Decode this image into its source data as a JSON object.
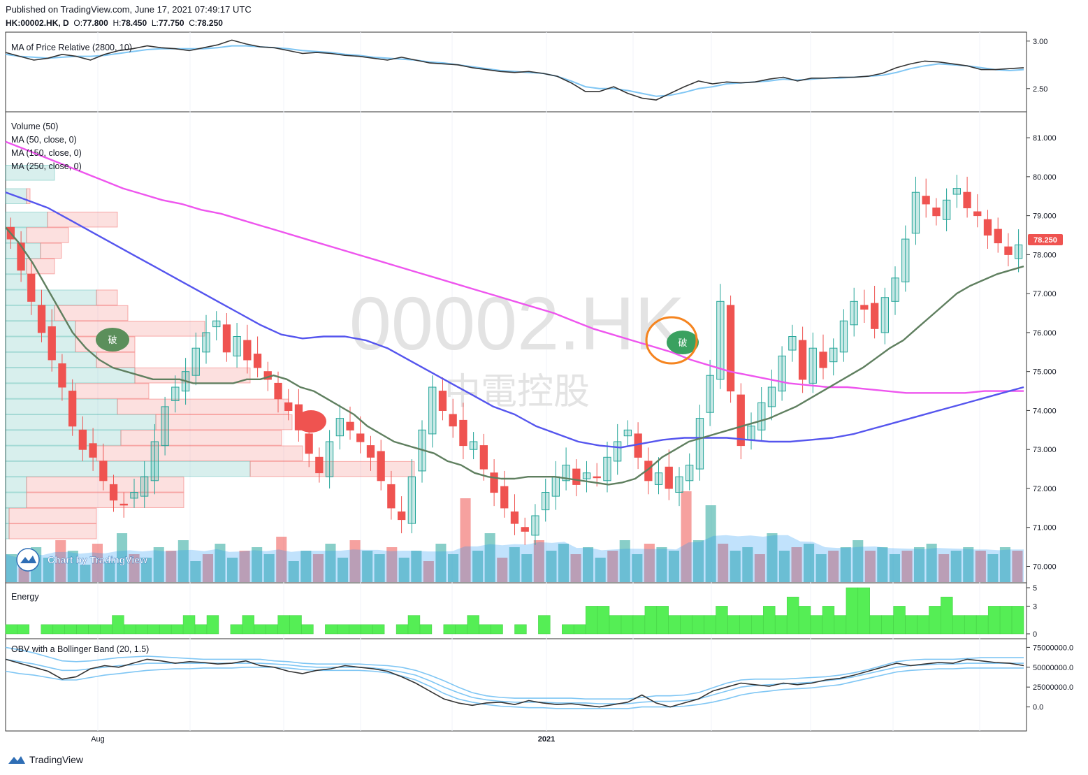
{
  "header": {
    "published": "Published on TradingView.com, June 17, 2021 07:49:17 UTC",
    "symbol_line": "HK:00002.HK, D",
    "ohlc": {
      "o": "77.800",
      "h": "78.450",
      "l": "77.750",
      "c": "78.250"
    }
  },
  "watermark": {
    "symbol": "00002.HK",
    "name": "中電控股"
  },
  "badge_text": "破",
  "brand": {
    "chart_by": "Chart by TradingView",
    "footer": "TradingView"
  },
  "colors": {
    "up": "#26a69a",
    "down": "#ef5350",
    "ma50": "#5f7f5f",
    "ma150": "#5555ee",
    "ma250": "#ee55ee",
    "energy": "#55ee55",
    "obv": "#333333",
    "band": "#7fc6f4",
    "annotation": "#f5841f"
  },
  "chart_data": [
    {
      "type": "line",
      "title": "MA of Price Relative (2800, 10)",
      "y_ticks": [
        "3.00",
        "2.50"
      ],
      "ylim": [
        2.3,
        3.05
      ],
      "series": [
        {
          "values": [
            2.88,
            2.84,
            2.8,
            2.82,
            2.86,
            2.84,
            2.8,
            2.86,
            2.9,
            2.92,
            2.95,
            2.93,
            2.92,
            2.9,
            2.93,
            2.96,
            3.01,
            2.97,
            2.94,
            2.93,
            2.9,
            2.87,
            2.88,
            2.87,
            2.85,
            2.84,
            2.82,
            2.8,
            2.83,
            2.8,
            2.77,
            2.76,
            2.75,
            2.72,
            2.7,
            2.68,
            2.67,
            2.68,
            2.66,
            2.63,
            2.56,
            2.47,
            2.47,
            2.52,
            2.45,
            2.4,
            2.38,
            2.45,
            2.52,
            2.58,
            2.55,
            2.57,
            2.56,
            2.57,
            2.6,
            2.62,
            2.58,
            2.61,
            2.61,
            2.62,
            2.62,
            2.63,
            2.66,
            2.72,
            2.76,
            2.79,
            2.78,
            2.76,
            2.74,
            2.7,
            2.7,
            2.71,
            2.72
          ]
        },
        {
          "values": [
            2.86,
            2.84,
            2.83,
            2.82,
            2.83,
            2.84,
            2.84,
            2.85,
            2.87,
            2.89,
            2.91,
            2.92,
            2.92,
            2.92,
            2.92,
            2.93,
            2.95,
            2.95,
            2.94,
            2.93,
            2.92,
            2.9,
            2.89,
            2.88,
            2.86,
            2.85,
            2.83,
            2.82,
            2.81,
            2.8,
            2.78,
            2.77,
            2.75,
            2.73,
            2.71,
            2.69,
            2.68,
            2.67,
            2.66,
            2.63,
            2.58,
            2.52,
            2.5,
            2.5,
            2.48,
            2.45,
            2.42,
            2.43,
            2.46,
            2.5,
            2.52,
            2.55,
            2.56,
            2.57,
            2.58,
            2.6,
            2.59,
            2.6,
            2.61,
            2.61,
            2.62,
            2.63,
            2.64,
            2.67,
            2.71,
            2.74,
            2.76,
            2.75,
            2.74,
            2.72,
            2.7,
            2.69,
            2.7
          ]
        }
      ]
    },
    {
      "type": "candlestick",
      "legend": [
        "Volume (50)",
        "MA (50, close, 0)",
        "MA (150, close, 0)",
        "MA (250, close, 0)"
      ],
      "y_ticks": [
        "81.000",
        "80.000",
        "79.000",
        "78.000",
        "77.000",
        "76.000",
        "75.000",
        "74.000",
        "73.000",
        "72.000",
        "71.000",
        "70.000"
      ],
      "ylim": [
        69.65,
        81.45
      ],
      "x_labels": [
        "Aug",
        "2021"
      ],
      "last_price": "78.250",
      "close": [
        78.4,
        77.6,
        76.8,
        76.0,
        75.3,
        74.6,
        73.6,
        73.0,
        72.8,
        72.2,
        71.7,
        71.6,
        71.9,
        72.3,
        73.2,
        74.1,
        74.6,
        75.0,
        75.6,
        76.0,
        76.3,
        75.5,
        75.9,
        75.3,
        75.1,
        74.8,
        74.3,
        74.0,
        73.5,
        72.9,
        72.4,
        73.2,
        73.8,
        73.5,
        73.2,
        72.8,
        72.2,
        71.5,
        71.2,
        72.3,
        73.5,
        74.6,
        74.0,
        73.6,
        73.1,
        73.2,
        72.5,
        71.9,
        71.5,
        71.1,
        70.9,
        71.3,
        71.9,
        72.3,
        72.6,
        72.1,
        72.4,
        72.3,
        72.8,
        73.2,
        73.5,
        72.8,
        72.2,
        72.4,
        72.0,
        72.3,
        72.6,
        73.8,
        74.9,
        76.8,
        74.5,
        73.1,
        73.6,
        74.2,
        74.6,
        75.4,
        75.9,
        74.8,
        75.6,
        75.1,
        75.6,
        76.3,
        76.8,
        76.6,
        76.1,
        76.9,
        77.4,
        78.4,
        79.6,
        79.3,
        79.0,
        79.4,
        79.7,
        79.2,
        79.0,
        78.5,
        78.3,
        78.0,
        78.25
      ],
      "ma50": [
        78.7,
        78.3,
        77.8,
        77.2,
        76.6,
        76.0,
        75.6,
        75.3,
        75.1,
        75.0,
        74.9,
        74.8,
        74.8,
        74.8,
        74.7,
        74.7,
        74.7,
        74.7,
        74.8,
        74.8,
        74.9,
        74.8,
        74.6,
        74.5,
        74.3,
        74.1,
        73.9,
        73.6,
        73.4,
        73.2,
        73.1,
        73.0,
        72.9,
        72.7,
        72.6,
        72.4,
        72.3,
        72.25,
        72.25,
        72.3,
        72.3,
        72.3,
        72.25,
        72.2,
        72.15,
        72.1,
        72.15,
        72.25,
        72.5,
        72.8,
        73.0,
        73.2,
        73.3,
        73.4,
        73.5,
        73.6,
        73.7,
        73.8,
        73.95,
        74.1,
        74.3,
        74.5,
        74.7,
        74.9,
        75.1,
        75.35,
        75.6,
        75.8,
        76.1,
        76.4,
        76.7,
        77.0,
        77.2,
        77.35,
        77.5,
        77.6,
        77.7
      ],
      "ma150": [
        79.6,
        79.4,
        79.2,
        78.9,
        78.6,
        78.3,
        78.0,
        77.7,
        77.4,
        77.1,
        76.8,
        76.5,
        76.2,
        75.95,
        75.85,
        75.9,
        75.9,
        75.8,
        75.6,
        75.3,
        75.0,
        74.7,
        74.4,
        74.1,
        73.9,
        73.6,
        73.4,
        73.2,
        73.1,
        73.05,
        73.15,
        73.25,
        73.3,
        73.3,
        73.3,
        73.25,
        73.2,
        73.2,
        73.25,
        73.3,
        73.4,
        73.55,
        73.7,
        73.85,
        74.0,
        74.15,
        74.3,
        74.45,
        74.6
      ],
      "ma250": [
        80.9,
        80.7,
        80.5,
        80.3,
        80.1,
        79.9,
        79.7,
        79.55,
        79.4,
        79.3,
        79.15,
        79.05,
        78.9,
        78.75,
        78.6,
        78.45,
        78.3,
        78.15,
        78.0,
        77.85,
        77.7,
        77.55,
        77.4,
        77.25,
        77.1,
        76.95,
        76.8,
        76.65,
        76.5,
        76.3,
        76.1,
        75.95,
        75.8,
        75.65,
        75.5,
        75.3,
        75.15,
        75.0,
        74.9,
        74.8,
        74.7,
        74.65,
        74.6,
        74.6,
        74.55,
        74.5,
        74.45,
        74.45,
        74.45,
        74.45,
        74.5,
        74.5,
        74.5
      ],
      "volume_profile": [
        {
          "price": 80.1,
          "up": 70,
          "down": 0
        },
        {
          "price": 79.5,
          "up": 30,
          "down": 5
        },
        {
          "price": 78.9,
          "up": 60,
          "down": 100
        },
        {
          "price": 78.5,
          "up": 30,
          "down": 60
        },
        {
          "price": 78.1,
          "up": 50,
          "down": 30
        },
        {
          "price": 77.7,
          "up": 30,
          "down": 40
        },
        {
          "price": 77.3,
          "up": 30,
          "down": 0
        },
        {
          "price": 76.9,
          "up": 130,
          "down": 30
        },
        {
          "price": 76.5,
          "up": 70,
          "down": 105
        },
        {
          "price": 76.1,
          "up": 100,
          "down": 185
        },
        {
          "price": 75.7,
          "up": 100,
          "down": 85
        },
        {
          "price": 75.3,
          "up": 130,
          "down": 55
        },
        {
          "price": 74.9,
          "up": 185,
          "down": 165
        },
        {
          "price": 74.5,
          "up": 100,
          "down": 105
        },
        {
          "price": 74.1,
          "up": 160,
          "down": 245
        },
        {
          "price": 73.7,
          "up": 215,
          "down": 195
        },
        {
          "price": 73.3,
          "up": 165,
          "down": 230
        },
        {
          "price": 72.9,
          "up": 130,
          "down": 295
        },
        {
          "price": 72.5,
          "up": 350,
          "down": 235
        },
        {
          "price": 72.1,
          "up": 30,
          "down": 225
        },
        {
          "price": 71.7,
          "up": 30,
          "down": 225
        },
        {
          "price": 71.3,
          "up": 5,
          "down": 125
        },
        {
          "price": 70.9,
          "up": 5,
          "down": 125
        }
      ],
      "volume": [
        40,
        30,
        50,
        35,
        60,
        45,
        25,
        55,
        30,
        70,
        40,
        35,
        50,
        45,
        60,
        30,
        40,
        55,
        35,
        45,
        50,
        40,
        65,
        30,
        45,
        40,
        55,
        35,
        60,
        45,
        40,
        50,
        35,
        45,
        30,
        55,
        40,
        120,
        45,
        70,
        35,
        50,
        40,
        60,
        45,
        55,
        40,
        50,
        35,
        45,
        60,
        40,
        55,
        50,
        45,
        130,
        60,
        110,
        55,
        45,
        50,
        40,
        70,
        45,
        50,
        55,
        40,
        45,
        50,
        60,
        45,
        50,
        40,
        45,
        50,
        55,
        40,
        45,
        50,
        45,
        40,
        50,
        45
      ]
    },
    {
      "type": "bar",
      "title": "Energy",
      "y_ticks": [
        "5",
        "3",
        "0"
      ],
      "ylim": [
        0,
        5
      ],
      "values": [
        1,
        1,
        0,
        1,
        1,
        1,
        1,
        1,
        1,
        2,
        1,
        1,
        1,
        1,
        1,
        2,
        1,
        2,
        0,
        1,
        2,
        1,
        1,
        2,
        2,
        1,
        0,
        1,
        1,
        1,
        1,
        1,
        0,
        1,
        2,
        1,
        0,
        1,
        1,
        2,
        1,
        1,
        0,
        1,
        0,
        2,
        0,
        1,
        1,
        3,
        3,
        2,
        2,
        2,
        3,
        3,
        2,
        2,
        2,
        2,
        3,
        2,
        2,
        2,
        3,
        2,
        4,
        3,
        2,
        3,
        2,
        5,
        5,
        2,
        2,
        3,
        2,
        2,
        3,
        4,
        2,
        2,
        2,
        3,
        3,
        3
      ]
    },
    {
      "type": "line",
      "title": "OBV with a Bollinger Band (20, 1.5)",
      "y_ticks": [
        "75000000.0",
        "50000000.0",
        "25000000.0",
        "0.0"
      ],
      "ylim": [
        -25000000,
        85000000
      ],
      "series": [
        {
          "values": [
            60,
            55,
            50,
            45,
            35,
            38,
            48,
            52,
            50,
            55,
            60,
            58,
            55,
            57,
            56,
            54,
            55,
            58,
            52,
            50,
            45,
            42,
            46,
            48,
            52,
            50,
            48,
            45,
            38,
            30,
            20,
            10,
            5,
            2,
            5,
            6,
            3,
            8,
            5,
            3,
            4,
            2,
            0,
            3,
            6,
            15,
            5,
            0,
            5,
            10,
            20,
            25,
            30,
            28,
            26,
            30,
            28,
            30,
            34,
            36,
            40,
            45,
            50,
            55,
            52,
            54,
            56,
            55,
            60,
            58,
            56,
            55,
            52
          ]
        },
        {
          "values": [
            75,
            72,
            68,
            63,
            58,
            57,
            58,
            60,
            62,
            63,
            64,
            63,
            62,
            61,
            60,
            60,
            60,
            60,
            60,
            58,
            57,
            55,
            54,
            54,
            54,
            54,
            53,
            52,
            50,
            46,
            40,
            33,
            25,
            18,
            14,
            12,
            11,
            11,
            11,
            11,
            11,
            10,
            10,
            10,
            10,
            12,
            14,
            14,
            15,
            18,
            24,
            30,
            34,
            35,
            35,
            35,
            36,
            37,
            38,
            40,
            43,
            47,
            52,
            57,
            59,
            60,
            60,
            60,
            61,
            62,
            62,
            62,
            62
          ]
        },
        {
          "values": [
            60,
            57,
            54,
            50,
            46,
            46,
            48,
            50,
            52,
            53,
            55,
            55,
            55,
            55,
            55,
            55,
            55,
            55,
            55,
            54,
            53,
            51,
            50,
            50,
            50,
            50,
            49,
            47,
            44,
            40,
            33,
            25,
            18,
            12,
            9,
            7,
            6,
            6,
            6,
            5,
            5,
            5,
            4,
            4,
            4,
            6,
            7,
            7,
            8,
            10,
            15,
            20,
            25,
            27,
            28,
            29,
            30,
            31,
            33,
            35,
            38,
            42,
            46,
            50,
            52,
            53,
            54,
            54,
            55,
            55,
            55,
            55,
            55
          ]
        },
        {
          "values": [
            45,
            42,
            40,
            37,
            34,
            34,
            37,
            40,
            42,
            44,
            46,
            47,
            48,
            48,
            49,
            49,
            49,
            50,
            50,
            50,
            49,
            47,
            46,
            46,
            46,
            46,
            45,
            43,
            39,
            34,
            26,
            17,
            10,
            6,
            3,
            1,
            0,
            -1,
            -1,
            -2,
            -2,
            -2,
            -2,
            -2,
            -2,
            0,
            0,
            0,
            1,
            3,
            6,
            10,
            15,
            18,
            20,
            22,
            23,
            24,
            26,
            28,
            32,
            36,
            40,
            44,
            46,
            47,
            48,
            48,
            49,
            49,
            49,
            49,
            49
          ]
        }
      ]
    }
  ]
}
